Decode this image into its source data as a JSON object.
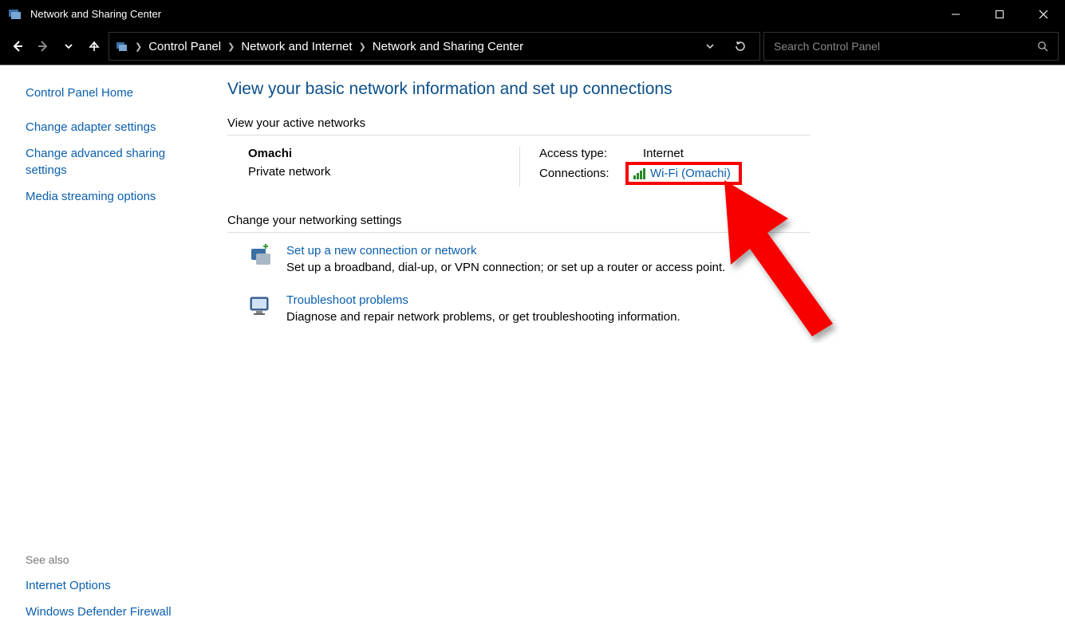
{
  "window": {
    "title": "Network and Sharing Center"
  },
  "breadcrumb": {
    "items": [
      "Control Panel",
      "Network and Internet",
      "Network and Sharing Center"
    ]
  },
  "search": {
    "placeholder": "Search Control Panel"
  },
  "sidebar": {
    "home": "Control Panel Home",
    "links": [
      "Change adapter settings",
      "Change advanced sharing settings",
      "Media streaming options"
    ],
    "see_also_title": "See also",
    "see_also": [
      "Internet Options",
      "Windows Defender Firewall"
    ]
  },
  "main": {
    "title": "View your basic network information and set up connections",
    "active_networks_head": "View your active networks",
    "network": {
      "name": "Omachi",
      "kind": "Private network",
      "access_type_label": "Access type:",
      "access_type_value": "Internet",
      "connections_label": "Connections:",
      "connection_link": "Wi-Fi (Omachi)"
    },
    "change_head": "Change your networking settings",
    "settings": [
      {
        "title": "Set up a new connection or network",
        "desc": "Set up a broadband, dial-up, or VPN connection; or set up a router or access point."
      },
      {
        "title": "Troubleshoot problems",
        "desc": "Diagnose and repair network problems, or get troubleshooting information."
      }
    ]
  }
}
